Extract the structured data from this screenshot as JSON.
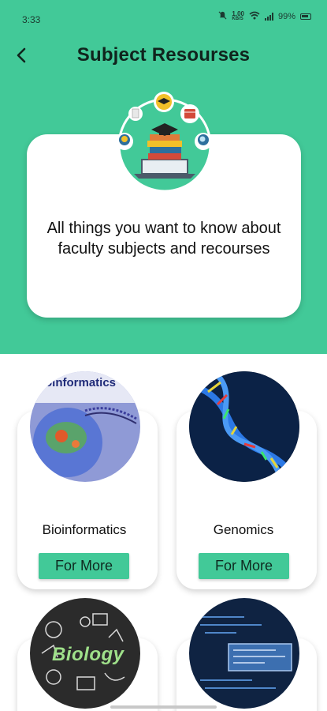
{
  "status_bar": {
    "time": "3:33",
    "net_speed": "1.00",
    "net_unit": "KB/S",
    "battery": "99%"
  },
  "header": {
    "title": "Subject Resourses"
  },
  "hero": {
    "text": "All things you want to know about faculty subjects and recourses"
  },
  "subjects": [
    {
      "title": "Bioinformatics",
      "button": "For More",
      "image_overlay": "Bioinformatics"
    },
    {
      "title": "Genomics",
      "button": "For More"
    },
    {
      "title": "",
      "button": "",
      "image_overlay": "Biology"
    },
    {
      "title": "",
      "button": ""
    }
  ],
  "colors": {
    "primary": "#42c998",
    "card": "#ffffff"
  }
}
